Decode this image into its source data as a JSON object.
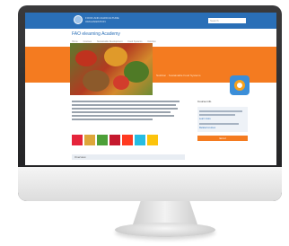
{
  "site": {
    "title": "FOOD AND AGRICULTURE ORGANIZATION",
    "search_placeholder": "Search"
  },
  "page": {
    "nav_title": "FAO elearning Academy",
    "breadcrumbs": [
      "Home",
      "Courses",
      "Sustainable Development",
      "Food Systems",
      "Nutrition"
    ],
    "band_caption": "Nutrition · Sustainable Food Systems",
    "section_label": "Overview"
  },
  "sidebar": {
    "heading": "Course info",
    "link_1": "Learn more",
    "link_2": "Related courses",
    "orange_button": "Enrol"
  },
  "sdg_tiles": [
    "#e5243b",
    "#dda63a",
    "#4c9f38",
    "#c5192d",
    "#ff3a21",
    "#26bde2",
    "#fcc30b"
  ],
  "colors": {
    "topbar": "#2a6fb7",
    "accent": "#f47b20"
  }
}
